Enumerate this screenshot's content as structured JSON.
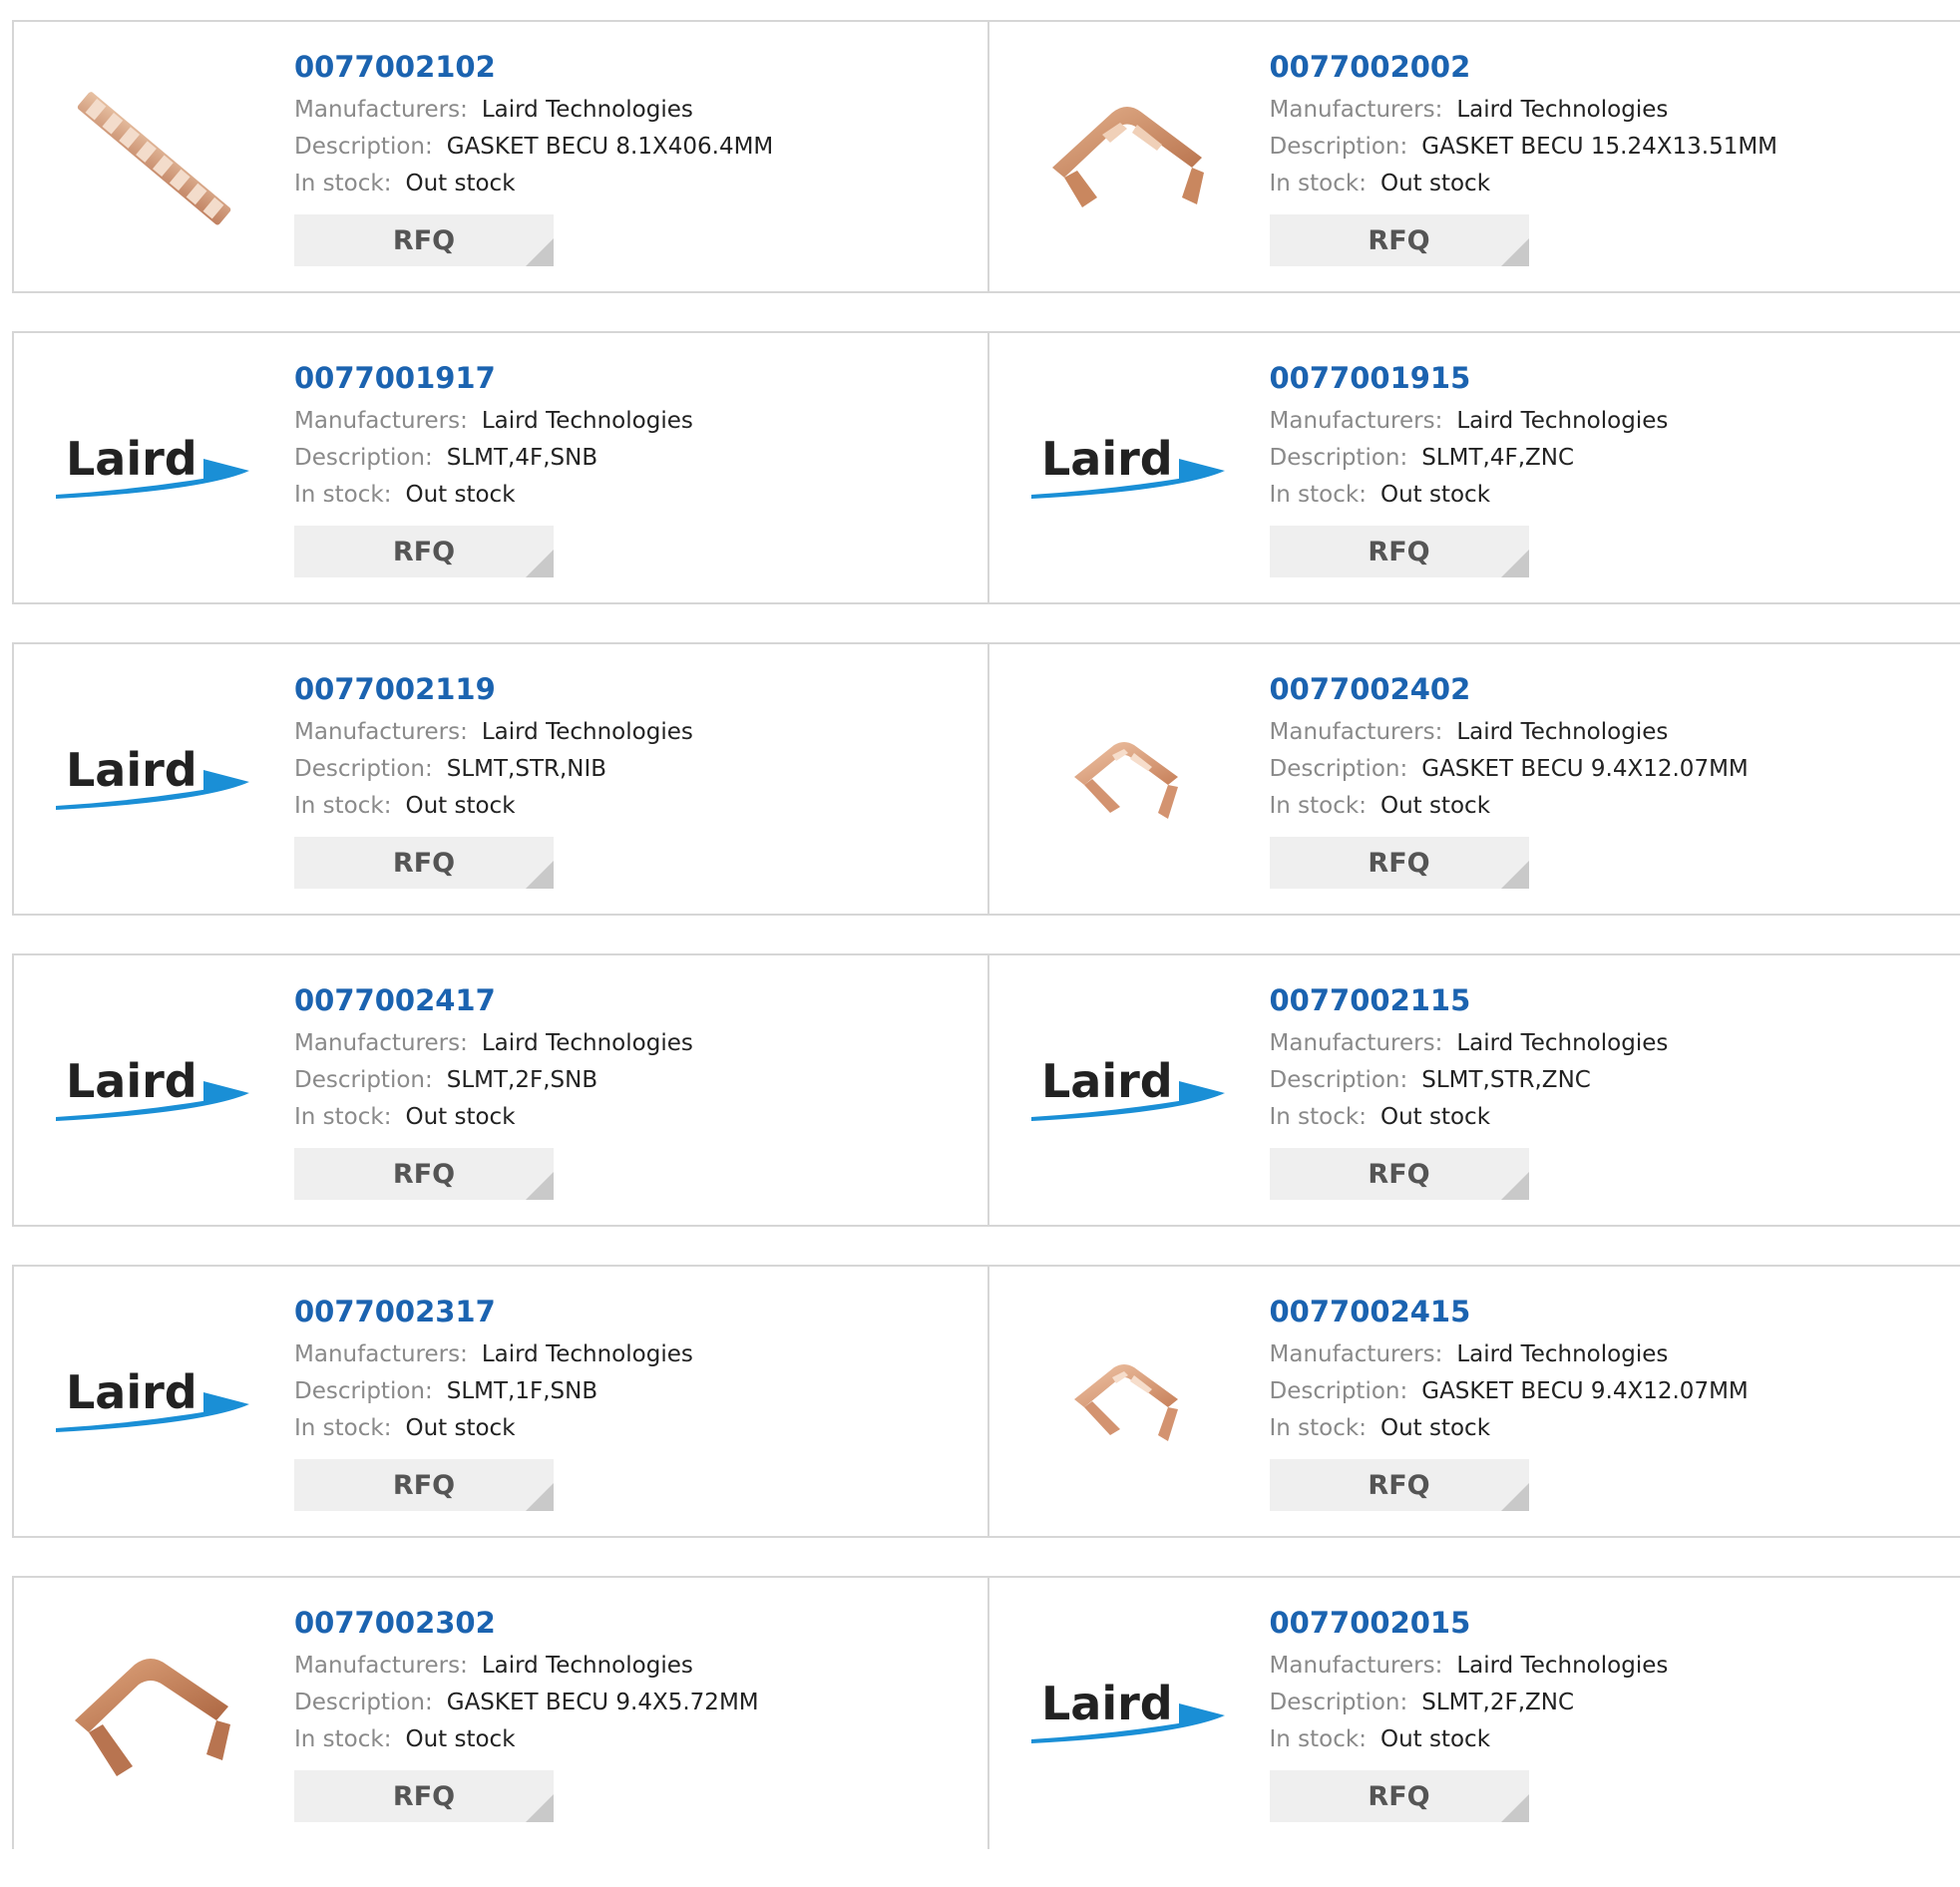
{
  "labels": {
    "manufacturers": "Manufacturers:",
    "description": "Description:",
    "in_stock": "In stock:",
    "rfq": "RFQ"
  },
  "logo_text": "Laird",
  "products": [
    {
      "pn": "0077002102",
      "manufacturer": "Laird Technologies",
      "description": "GASKET BECU 8.1X406.4MM",
      "stock": "Out stock",
      "image": "gasket-strip-image"
    },
    {
      "pn": "0077002002",
      "manufacturer": "Laird Technologies",
      "description": "GASKET BECU 15.24X13.51MM",
      "stock": "Out stock",
      "image": "gasket-clip-image"
    },
    {
      "pn": "0077001917",
      "manufacturer": "Laird Technologies",
      "description": "SLMT,4F,SNB",
      "stock": "Out stock",
      "image": "laird-logo"
    },
    {
      "pn": "0077001915",
      "manufacturer": "Laird Technologies",
      "description": "SLMT,4F,ZNC",
      "stock": "Out stock",
      "image": "laird-logo"
    },
    {
      "pn": "0077002119",
      "manufacturer": "Laird Technologies",
      "description": "SLMT,STR,NIB",
      "stock": "Out stock",
      "image": "laird-logo"
    },
    {
      "pn": "0077002402",
      "manufacturer": "Laird Technologies",
      "description": "GASKET BECU 9.4X12.07MM",
      "stock": "Out stock",
      "image": "gasket-small-clip-image"
    },
    {
      "pn": "0077002417",
      "manufacturer": "Laird Technologies",
      "description": "SLMT,2F,SNB",
      "stock": "Out stock",
      "image": "laird-logo"
    },
    {
      "pn": "0077002115",
      "manufacturer": "Laird Technologies",
      "description": "SLMT,STR,ZNC",
      "stock": "Out stock",
      "image": "laird-logo"
    },
    {
      "pn": "0077002317",
      "manufacturer": "Laird Technologies",
      "description": "SLMT,1F,SNB",
      "stock": "Out stock",
      "image": "laird-logo"
    },
    {
      "pn": "0077002415",
      "manufacturer": "Laird Technologies",
      "description": "GASKET BECU 9.4X12.07MM",
      "stock": "Out stock",
      "image": "gasket-small-clip-image"
    },
    {
      "pn": "0077002302",
      "manufacturer": "Laird Technologies",
      "description": "GASKET BECU 9.4X5.72MM",
      "stock": "Out stock",
      "image": "gasket-wide-clip-image"
    },
    {
      "pn": "0077002015",
      "manufacturer": "Laird Technologies",
      "description": "SLMT,2F,ZNC",
      "stock": "Out stock",
      "image": "laird-logo"
    }
  ]
}
